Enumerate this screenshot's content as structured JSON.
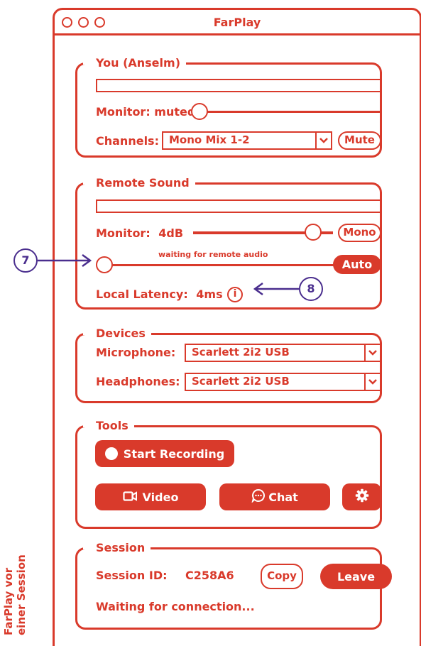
{
  "window": {
    "title": "FarPlay"
  },
  "you_group": {
    "legend": "You (Anselm)",
    "monitor_label": "Monitor: muted",
    "channels_label": "Channels:",
    "channels_value": "Mono Mix 1-2",
    "mute_label": "Mute"
  },
  "remote_group": {
    "legend": "Remote Sound",
    "monitor_label": "Monitor:",
    "monitor_value": "4dB",
    "mono_label": "Mono",
    "waiting_text": "waiting for remote audio",
    "auto_label": "Auto",
    "latency_label": "Local Latency:",
    "latency_value": "4ms",
    "info_glyph": "i"
  },
  "devices_group": {
    "legend": "Devices",
    "microphone_label": "Microphone:",
    "microphone_value": "Scarlett 2i2 USB",
    "headphones_label": "Headphones:",
    "headphones_value": "Scarlett 2i2 USB"
  },
  "tools_group": {
    "legend": "Tools",
    "record_label": "Start Recording",
    "video_label": "Video",
    "chat_label": "Chat",
    "icons": {
      "record": "record-dot-icon",
      "video": "video-camera-icon",
      "chat": "chat-bubble-icon",
      "settings": "gear-icon"
    }
  },
  "session_group": {
    "legend": "Session",
    "session_id_label": "Session ID:",
    "session_id_value": "C258A6",
    "copy_label": "Copy",
    "leave_label": "Leave",
    "status_text": "Waiting for connection..."
  },
  "callouts": {
    "left_number": "7",
    "right_number": "8"
  },
  "side_caption": {
    "line1": "FarPlay vor",
    "line2": "einer Session"
  },
  "colors": {
    "accent": "#d93a2b",
    "callout": "#4a2e8e",
    "background": "#ffffff"
  }
}
